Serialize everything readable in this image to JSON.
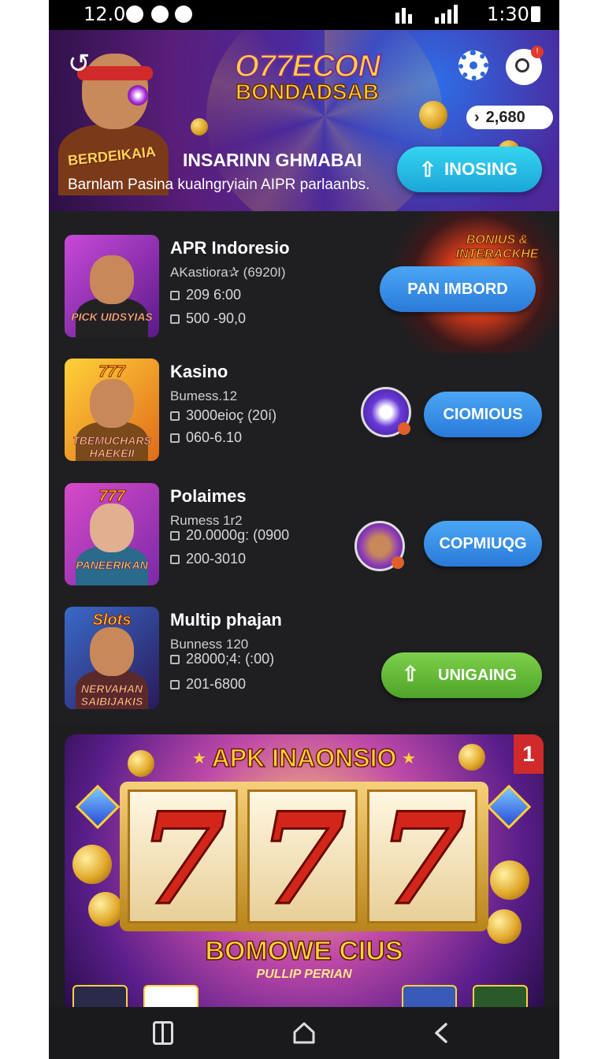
{
  "status_bar": {
    "time_left": "12.0",
    "time_right": "1:30"
  },
  "header": {
    "logo_line1": "O77ECON",
    "logo_line2": "BONDADSAB",
    "mascot_label": "BERDEIKAIA",
    "notification_count": "!",
    "coins": "2,680",
    "subtitle": "INSARINN GHMABAI",
    "description": "Barnlam Pasina kualngryiain AIPR parlaanbs.",
    "cta_label": "INOSING"
  },
  "promo_burst": {
    "text": "BONIUS & INTERACKHE"
  },
  "games": [
    {
      "title": "APR Indoresio",
      "subtitle": "AKastiora✰ (6920I)",
      "row1": "209  6:00",
      "row2": "500 -90,0",
      "button": "PAN IMBORD",
      "thumb_top": "",
      "thumb_label": "PICK UIDSYIAS"
    },
    {
      "title": "Kasino",
      "subtitle": "Bumess.12",
      "row1": "3000eioç (20í)",
      "row2": "060-6.10",
      "button": "CIOMIOUS",
      "thumb_top": "777",
      "thumb_label": "TBEMUCHARS HAEKEII"
    },
    {
      "title": "Polaimes",
      "subtitle": "Rumess 1r2",
      "row1": "20.0000g: (0900",
      "row2": "200-3010",
      "button": "COPMIUQG",
      "thumb_top": "777",
      "thumb_label": "PANEERIKAN"
    },
    {
      "title": "Multip phajan",
      "subtitle": "Bunness 120",
      "row1": "28000;4: (:00)",
      "row2": "201-6800",
      "button": "UNIGAING",
      "thumb_top": "Slots",
      "thumb_label": "NERVAHAN SAIBIJAKIS"
    }
  ],
  "promo": {
    "title": "APK INAONSIO",
    "corner_badge": "1",
    "reels": [
      "7",
      "7",
      "7"
    ],
    "bonus_title": "BOMOWE CIUS",
    "bonus_subtitle": "PULLIP PERIAN"
  },
  "colors": {
    "accent_cyan": "#1aa6d8",
    "accent_blue": "#2a7ad8",
    "accent_green": "#4ea42a",
    "gold": "#ffd23a"
  }
}
